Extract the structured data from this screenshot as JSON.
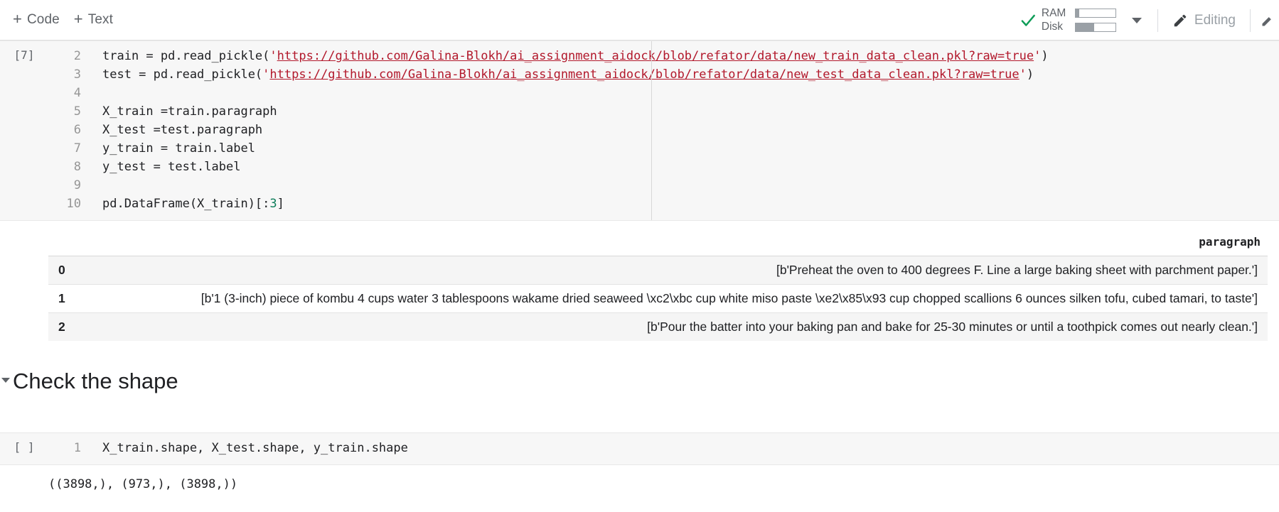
{
  "toolbar": {
    "add_code_label": "Code",
    "add_text_label": "Text",
    "plus_glyph": "+",
    "connected_icon": "green-check-icon",
    "ram_label": "RAM",
    "disk_label": "Disk",
    "ram_fill_percent": 9,
    "disk_fill_percent": 47,
    "resources_caret_icon": "chevron-down-icon",
    "editing_label": "Editing",
    "editing_icon": "pencil-icon",
    "accent_green": "#0f9d58",
    "muted_gray": "#5f6368"
  },
  "cells": [
    {
      "exec_count": "[7]",
      "lines": [
        {
          "no": "2",
          "parts": [
            {
              "t": "plain",
              "v": "train = pd.read_pickle("
            },
            {
              "t": "str",
              "v": "'"
            },
            {
              "t": "url",
              "v": "https://github.com/Galina-Blokh/ai_assignment_aidock/blob/refator/data/new_train_data_clean.pkl?raw=true"
            },
            {
              "t": "str",
              "v": "'"
            },
            {
              "t": "plain",
              "v": ")"
            }
          ]
        },
        {
          "no": "3",
          "parts": [
            {
              "t": "plain",
              "v": "test = pd.read_pickle("
            },
            {
              "t": "str",
              "v": "'"
            },
            {
              "t": "url",
              "v": "https://github.com/Galina-Blokh/ai_assignment_aidock/blob/refator/data/new_test_data_clean.pkl?raw=true"
            },
            {
              "t": "str",
              "v": "'"
            },
            {
              "t": "plain",
              "v": ")"
            }
          ]
        },
        {
          "no": "4",
          "parts": []
        },
        {
          "no": "5",
          "parts": [
            {
              "t": "plain",
              "v": "X_train =train.paragraph"
            }
          ]
        },
        {
          "no": "6",
          "parts": [
            {
              "t": "plain",
              "v": "X_test =test.paragraph"
            }
          ]
        },
        {
          "no": "7",
          "parts": [
            {
              "t": "plain",
              "v": "y_train = train.label"
            }
          ]
        },
        {
          "no": "8",
          "parts": [
            {
              "t": "plain",
              "v": "y_test = test.label"
            }
          ]
        },
        {
          "no": "9",
          "parts": []
        },
        {
          "no": "10",
          "parts": [
            {
              "t": "plain",
              "v": "pd.DataFrame(X_train)[:"
            },
            {
              "t": "num",
              "v": "3"
            },
            {
              "t": "plain",
              "v": "]"
            }
          ]
        }
      ]
    }
  ],
  "dataframe": {
    "index_header": "",
    "columns": [
      "paragraph"
    ],
    "rows": [
      {
        "index": "0",
        "cells": [
          "[b'Preheat the oven to 400 degrees F. Line a large baking sheet with parchment paper.']"
        ]
      },
      {
        "index": "1",
        "cells": [
          "[b'1 (3-inch) piece of kombu 4 cups water 3 tablespoons wakame dried seaweed \\xc2\\xbc cup white miso paste \\xe2\\x85\\x93 cup chopped scallions 6 ounces silken tofu, cubed tamari, to taste']"
        ]
      },
      {
        "index": "2",
        "cells": [
          "[b'Pour the batter into your baking pan and bake for 25-30 minutes or until a toothpick comes out nearly clean.']"
        ]
      }
    ]
  },
  "markdown": {
    "heading": "Check the shape",
    "collapse_icon": "triangle-down-icon"
  },
  "bottom_cell": {
    "exec_count": "[ ]",
    "lines": [
      {
        "no": "1",
        "parts": [
          {
            "t": "plain",
            "v": "X_train.shape, X_test.shape, y_train.shape"
          }
        ]
      }
    ],
    "output_text": "((3898,), (973,), (3898,))"
  }
}
